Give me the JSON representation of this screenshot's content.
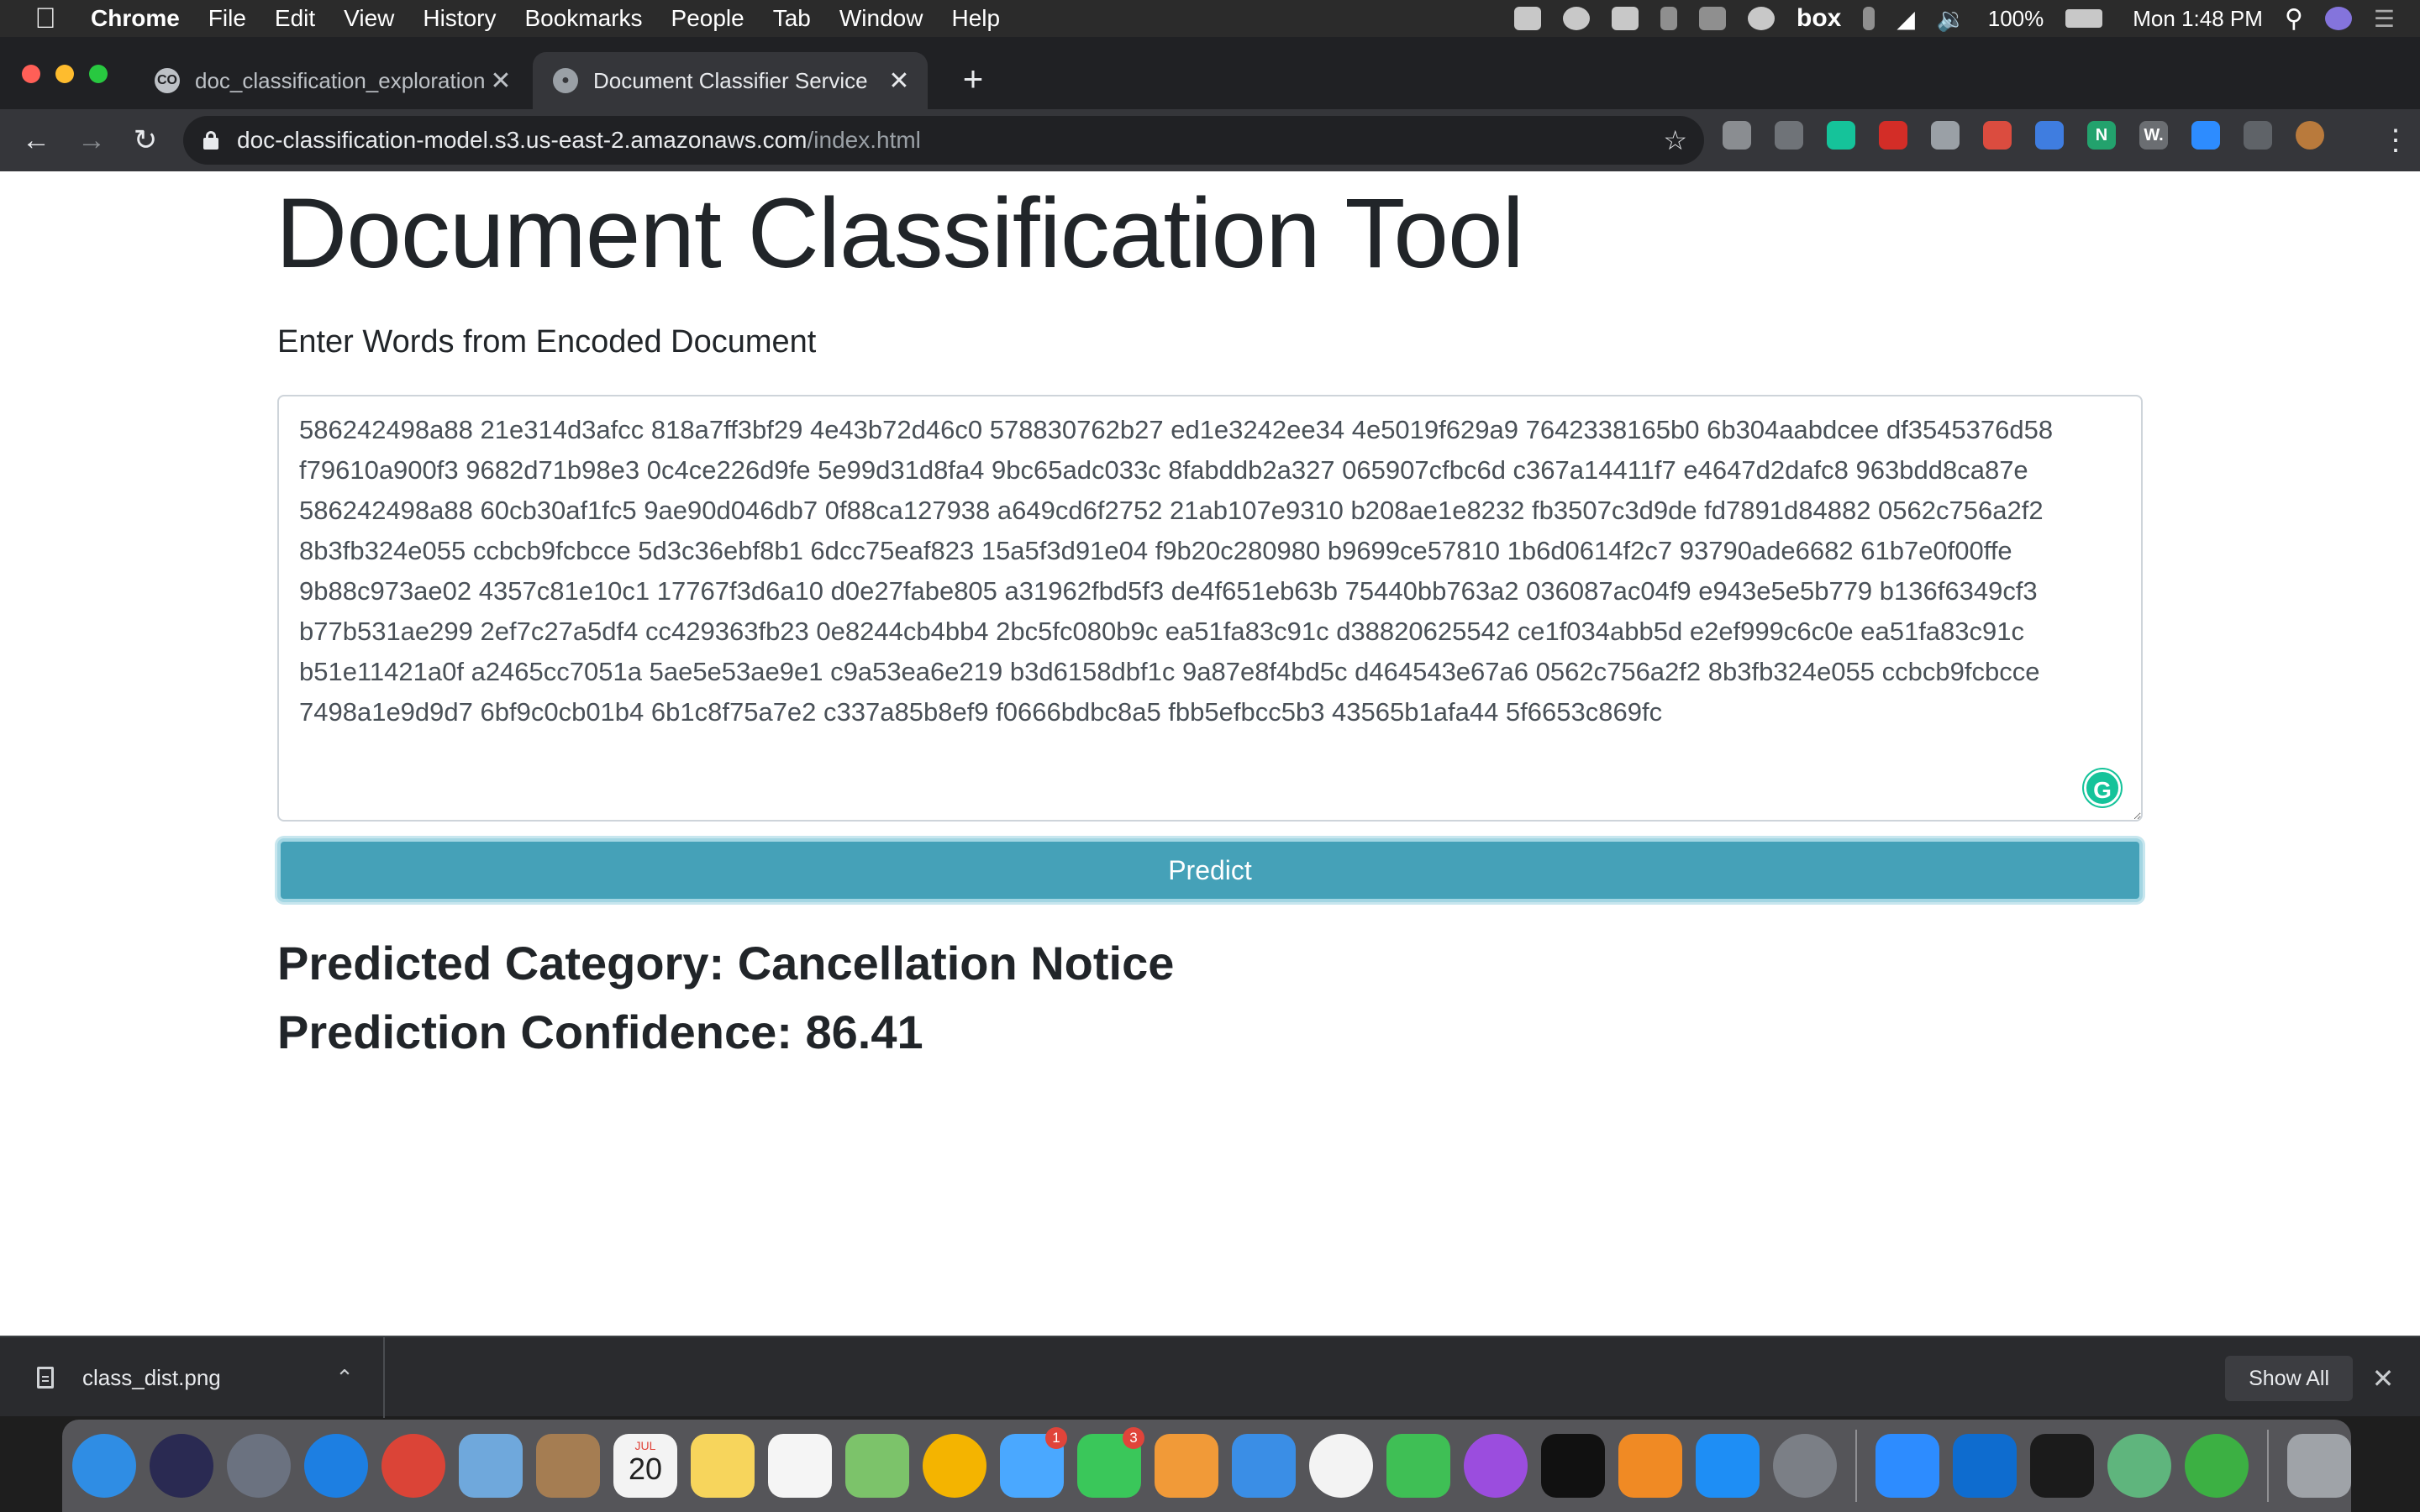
{
  "menubar": {
    "apple_glyph": "",
    "items": [
      "Chrome",
      "File",
      "Edit",
      "View",
      "History",
      "Bookmarks",
      "People",
      "Tab",
      "Window",
      "Help"
    ],
    "status": {
      "battery": "100%",
      "clock": "Mon 1:48 PM",
      "icons": [
        "zoom-icon",
        "creative-cloud-icon",
        "teamviewer-icon",
        "keychain-icon",
        "dropbox-icon",
        "cloud-upload-icon",
        "box-icon",
        "bluetooth-icon",
        "wifi-icon",
        "volume-icon",
        "battery-icon",
        "spotlight-icon",
        "siri-icon",
        "notification-center-icon"
      ],
      "box_label": "box"
    }
  },
  "tabs": [
    {
      "title": "doc_classification_exploration.i",
      "favicon": "CO",
      "active": false
    },
    {
      "title": "Document Classifier Service",
      "favicon": "globe",
      "active": true
    }
  ],
  "toolbar": {
    "url_host": "doc-classification-model.s3.us-east-2.amazonaws.com",
    "url_path": "/index.html",
    "extensions": [
      {
        "name": "extension-circle-icon",
        "color": "#8a8d91"
      },
      {
        "name": "google-drive-icon",
        "color": "#6f7378"
      },
      {
        "name": "grammarly-ext-icon",
        "color": "#15c39a"
      },
      {
        "name": "lastpass-icon",
        "color": "#d32d27"
      },
      {
        "name": "shield-ext-icon",
        "color": "#9aa0a6"
      },
      {
        "name": "todoist-icon",
        "color": "#db4c3f"
      },
      {
        "name": "pointer-ext-icon",
        "color": "#3f7de0"
      },
      {
        "name": "notion-web-clipper-icon",
        "color": "#23a26d",
        "label": "N"
      },
      {
        "name": "wordtune-icon",
        "color": "#6b6e72",
        "label": "W."
      },
      {
        "name": "zoom-ext-icon",
        "color": "#2d8cff"
      },
      {
        "name": "puzzle-extensions-icon",
        "color": "#5f6368"
      },
      {
        "name": "profile-avatar",
        "color": "#b97a3c"
      }
    ]
  },
  "page": {
    "title": "Document Classification Tool",
    "input_label": "Enter Words from Encoded Document",
    "input_value": "586242498a88 21e314d3afcc 818a7ff3bf29 4e43b72d46c0 578830762b27 ed1e3242ee34 4e5019f629a9 7642338165b0 6b304aabdcee df3545376d58 f79610a900f3 9682d71b98e3 0c4ce226d9fe 5e99d31d8fa4 9bc65adc033c 8fabddb2a327 065907cfbc6d c367a14411f7 e4647d2dafc8 963bdd8ca87e 586242498a88 60cb30af1fc5 9ae90d046db7 0f88ca127938 a649cd6f2752 21ab107e9310 b208ae1e8232 fb3507c3d9de fd7891d84882 0562c756a2f2 8b3fb324e055 ccbcb9fcbcce 5d3c36ebf8b1 6dcc75eaf823 15a5f3d91e04 f9b20c280980 b9699ce57810 1b6d0614f2c7 93790ade6682 61b7e0f00ffe 9b88c973ae02 4357c81e10c1 17767f3d6a10 d0e27fabe805 a31962fbd5f3 de4f651eb63b 75440bb763a2 036087ac04f9 e943e5e5b779 b136f6349cf3 b77b531ae299 2ef7c27a5df4 cc429363fb23 0e8244cb4bb4 2bc5fc080b9c ea51fa83c91c d38820625542 ce1f034abb5d e2ef999c6c0e ea51fa83c91c b51e11421a0f a2465cc7051a 5ae5e53ae9e1 c9a53ea6e219 b3d6158dbf1c 9a87e8f4bd5c d464543e67a6 0562c756a2f2 8b3fb324e055 ccbcb9fcbcce 7498a1e9d9d7 6bf9c0cb01b4 6b1c8f75a7e2 c337a85b8ef9 f0666bdbc8a5 fbb5efbcc5b3 43565b1afa44 5f6653c869fc",
    "predict_label": "Predict",
    "predicted_category": "Predicted Category: Cancellation Notice",
    "prediction_confidence": "Prediction Confidence: 86.41",
    "colors": {
      "button": "#45a1b8",
      "text": "#212529"
    }
  },
  "downloads": {
    "filename": "class_dist.png",
    "show_all": "Show All"
  },
  "dock": {
    "apps": [
      {
        "name": "finder-icon",
        "color": "#2f8de4"
      },
      {
        "name": "siri-dock-icon",
        "color": "#2a2a52"
      },
      {
        "name": "launchpad-icon",
        "color": "#6b7280"
      },
      {
        "name": "safari-icon",
        "color": "#1d7fe2"
      },
      {
        "name": "chrome-icon",
        "color": "#db4437"
      },
      {
        "name": "mail-icon",
        "color": "#6fa8dc"
      },
      {
        "name": "contacts-icon",
        "color": "#a57d52"
      },
      {
        "name": "calendar-icon",
        "color": "#f3f3f3"
      },
      {
        "name": "notes-icon",
        "color": "#f7d55c"
      },
      {
        "name": "reminders-icon",
        "color": "#f5f5f5"
      },
      {
        "name": "maps-icon",
        "color": "#7cc36a"
      },
      {
        "name": "photos-icon",
        "color": "#f4b400"
      },
      {
        "name": "messages-icon",
        "color": "#4aa8ff",
        "badge": "1"
      },
      {
        "name": "facetime-icon",
        "color": "#3ac75a",
        "badge": "3"
      },
      {
        "name": "pages-icon",
        "color": "#f19a38"
      },
      {
        "name": "keynote-icon",
        "color": "#3a8ee6"
      },
      {
        "name": "music-icon",
        "color": "#f3f3f3"
      },
      {
        "name": "numbers-icon",
        "color": "#3fbf55"
      },
      {
        "name": "podcasts-icon",
        "color": "#9b4dde"
      },
      {
        "name": "apple-tv-icon",
        "color": "#111111"
      },
      {
        "name": "books-icon",
        "color": "#f08a24"
      },
      {
        "name": "app-store-icon",
        "color": "#1e8ef5"
      },
      {
        "name": "system-preferences-icon",
        "color": "#7b7f86"
      },
      {
        "name": "zoom-app-icon",
        "color": "#2d8cff"
      },
      {
        "name": "teamviewer-app-icon",
        "color": "#0e6ccf"
      },
      {
        "name": "terminal-icon",
        "color": "#1b1b1b"
      },
      {
        "name": "atom-icon",
        "color": "#5fb57d"
      },
      {
        "name": "activity-ring-icon",
        "color": "#3cb043"
      },
      {
        "name": "trash-icon",
        "color": "#9fa3a8"
      }
    ],
    "calendar_month": "JUL",
    "calendar_day": "20"
  }
}
